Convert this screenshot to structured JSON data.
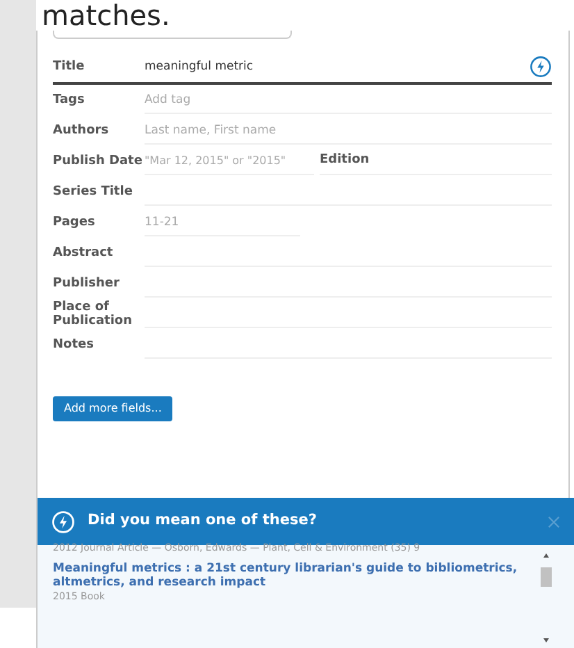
{
  "heading_fragment": "matches.",
  "form": {
    "fields": [
      {
        "label": "Title",
        "value": "meaningful metric",
        "focused": true,
        "kind": "text"
      },
      {
        "label": "Tags",
        "placeholder": "Add tag",
        "focused": false,
        "kind": "text"
      },
      {
        "label": "Authors",
        "placeholder": "Last name, First name",
        "focused": false,
        "kind": "text"
      },
      {
        "label": "Publish Date",
        "placeholder": "\"Mar 12, 2015\" or \"2015\"",
        "focused": false,
        "kind": "pair",
        "second_label": "Edition"
      },
      {
        "label": "Series Title",
        "focused": false,
        "kind": "text"
      },
      {
        "label": "Pages",
        "placeholder": "11-21",
        "focused": false,
        "kind": "short"
      },
      {
        "label": "Abstract",
        "focused": false,
        "kind": "text"
      },
      {
        "label": "Publisher",
        "focused": false,
        "kind": "text"
      },
      {
        "label": "Place of Publication",
        "focused": false,
        "kind": "text"
      },
      {
        "label": "Notes",
        "focused": false,
        "kind": "text"
      }
    ],
    "add_button": "Add more fields..."
  },
  "suggestions": {
    "title": "Did you mean one of these?",
    "items": [
      {
        "meta": "2012 Journal Article — Osborn, Edwards — Plant, Cell & Environment (35) 9"
      },
      {
        "title": "Meaningful metrics : a 21st century librarian's guide to bibliometrics, altmetrics, and research impact",
        "meta": "2015 Book"
      }
    ]
  }
}
